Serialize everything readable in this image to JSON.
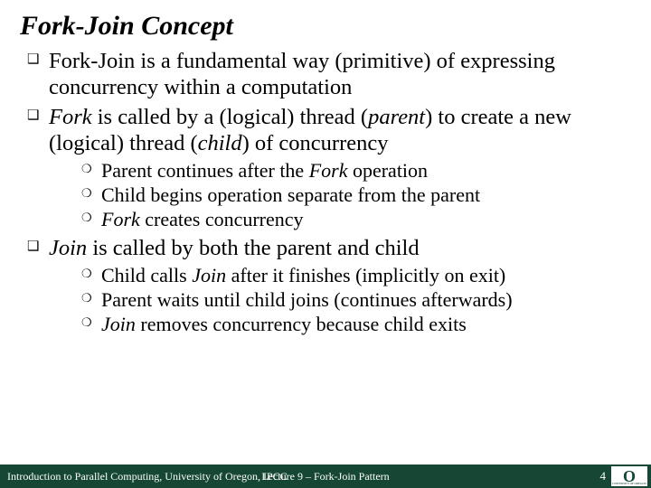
{
  "title": "Fork-Join Concept",
  "bullets": {
    "b1_a": "Fork-Join is a fundamental way (primitive) of expressing concurrency within a computation",
    "b2_pre": "Fork",
    "b2_post": " is called by a (logical) thread (",
    "b2_parent": "parent",
    "b2_mid": ") to create a new (logical) thread (",
    "b2_child": "child",
    "b2_end": ") of concurrency",
    "b2_s1_a": "Parent continues after the ",
    "b2_s1_b": "Fork",
    "b2_s1_c": " operation",
    "b2_s2": "Child begins operation separate from the parent",
    "b2_s3_a": "Fork",
    "b2_s3_b": " creates concurrency",
    "b3_pre": "Join",
    "b3_post": " is called by both the parent and child",
    "b3_s1_a": "Child calls ",
    "b3_s1_b": "Join",
    "b3_s1_c": " after it finishes (implicitly on exit)",
    "b3_s2": "Parent waits until child joins (continues afterwards)",
    "b3_s3_a": "Join",
    "b3_s3_b": " removes concurrency because child exits"
  },
  "footer": {
    "left": "Introduction to Parallel Computing, University of Oregon, IPCC",
    "center": "Lecture 9 – Fork-Join Pattern",
    "page": "4"
  },
  "logo": {
    "letter": "O",
    "text": "UNIVERSITY OF OREGON"
  }
}
